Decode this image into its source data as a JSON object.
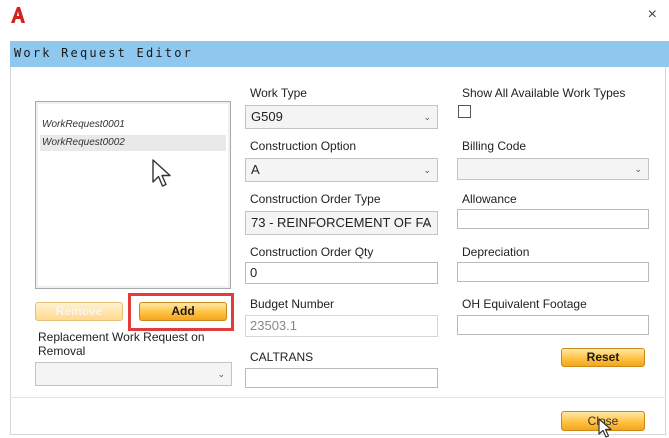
{
  "window": {
    "title": "Work Request Editor",
    "close_glyph": "×",
    "logo": "A"
  },
  "work_requests": {
    "items": [
      {
        "label": "WorkRequest0001",
        "selected": false
      },
      {
        "label": "WorkRequest0002",
        "selected": true
      }
    ],
    "remove_label": "Remove",
    "add_label": "Add",
    "replacement_label": "Replacement Work Request on Removal",
    "replacement_value": ""
  },
  "form": {
    "work_type_label": "Work Type",
    "work_type_value": "G509",
    "construction_option_label": "Construction Option",
    "construction_option_value": "A",
    "construction_order_type_label": "Construction Order Type",
    "construction_order_type_value": "73 - REINFORCEMENT OF FA",
    "construction_order_qty_label": "Construction Order Qty",
    "construction_order_qty_value": "0",
    "budget_number_label": "Budget Number",
    "budget_number_value": "23503.1",
    "caltrans_label": "CALTRANS",
    "caltrans_value": "",
    "show_all_label": "Show All Available Work Types",
    "show_all_checked": false,
    "billing_code_label": "Billing Code",
    "billing_code_value": "",
    "allowance_label": "Allowance",
    "allowance_value": "",
    "depreciation_label": "Depreciation",
    "depreciation_value": "",
    "oh_equiv_label": "OH Equivalent Footage",
    "oh_equiv_value": "",
    "reset_label": "Reset"
  },
  "footer": {
    "close_label": "Close"
  },
  "colors": {
    "titlebar": "#8ec8ee",
    "button_orange": "#ffc54a",
    "highlight_red": "#e33a3a",
    "logo_red": "#d62020"
  }
}
